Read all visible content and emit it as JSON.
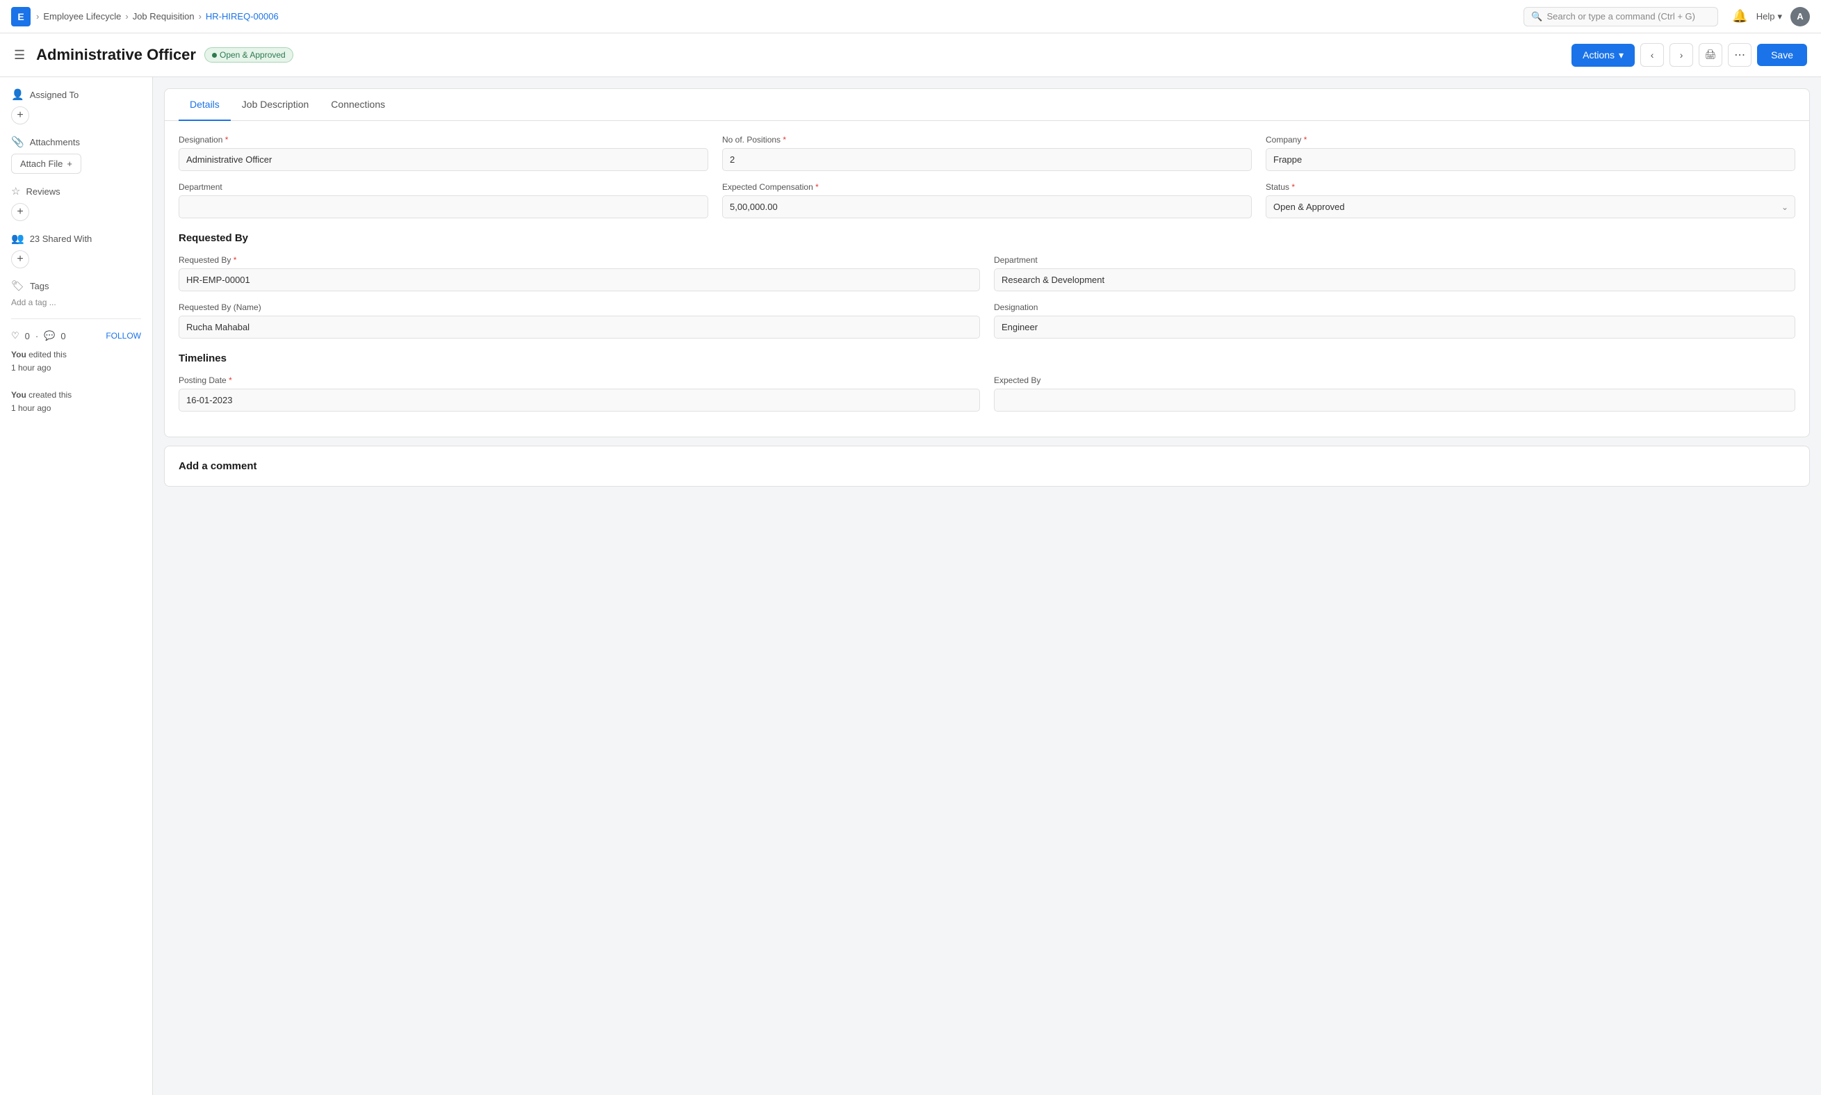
{
  "app": {
    "logo_letter": "E"
  },
  "breadcrumb": {
    "items": [
      {
        "label": "Employee Lifecycle"
      },
      {
        "label": "Job Requisition"
      },
      {
        "label": "HR-HIREQ-00006"
      }
    ]
  },
  "search": {
    "placeholder": "Search or type a command (Ctrl + G)"
  },
  "nav": {
    "help_label": "Help",
    "avatar_letter": "A"
  },
  "header": {
    "title": "Administrative Officer",
    "status": "Open & Approved",
    "actions_label": "Actions",
    "save_label": "Save"
  },
  "sidebar": {
    "assigned_to_label": "Assigned To",
    "attachments_label": "Attachments",
    "attach_file_label": "Attach File",
    "reviews_label": "Reviews",
    "shared_with_label": "23 Shared With",
    "tags_label": "Tags",
    "add_tag_label": "Add a tag ...",
    "likes_count": "0",
    "comments_count": "0",
    "follow_label": "FOLLOW",
    "activity": [
      {
        "actor": "You",
        "action": "edited this",
        "time": "1 hour ago"
      },
      {
        "actor": "You",
        "action": "created this",
        "time": "1 hour ago"
      }
    ]
  },
  "tabs": [
    {
      "label": "Details",
      "active": true
    },
    {
      "label": "Job Description",
      "active": false
    },
    {
      "label": "Connections",
      "active": false
    }
  ],
  "details": {
    "designation_label": "Designation",
    "designation_value": "Administrative Officer",
    "no_positions_label": "No of. Positions",
    "no_positions_value": "2",
    "company_label": "Company",
    "company_value": "Frappe",
    "department_label": "Department",
    "department_value": "",
    "expected_compensation_label": "Expected Compensation",
    "expected_compensation_value": "5,00,000.00",
    "status_label": "Status",
    "status_value": "Open & Approved",
    "requested_by_section": "Requested By",
    "requested_by_label": "Requested By",
    "requested_by_value": "HR-EMP-00001",
    "req_dept_label": "Department",
    "req_dept_value": "Research & Development",
    "requested_by_name_label": "Requested By (Name)",
    "requested_by_name_value": "Rucha Mahabal",
    "req_designation_label": "Designation",
    "req_designation_value": "Engineer",
    "timelines_section": "Timelines",
    "posting_date_label": "Posting Date",
    "posting_date_value": "16-01-2023",
    "expected_by_label": "Expected By",
    "expected_by_value": ""
  },
  "comment_section": {
    "heading": "Add a comment"
  }
}
